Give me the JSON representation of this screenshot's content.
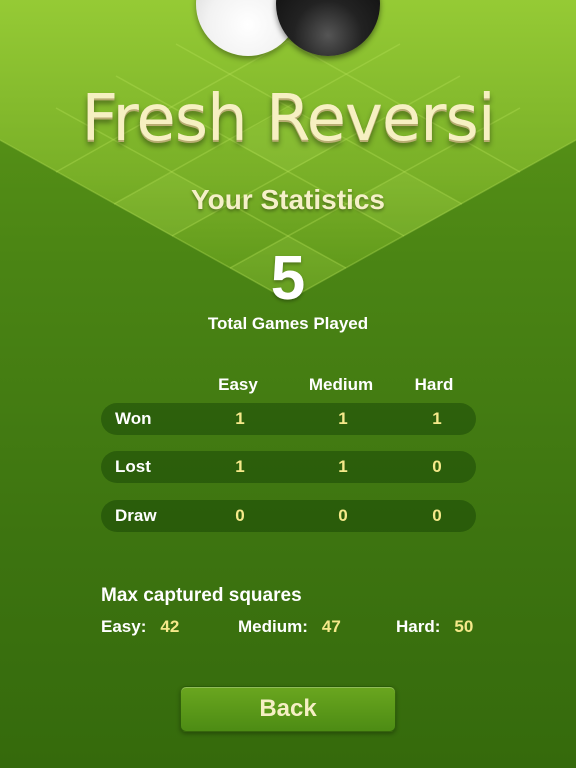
{
  "app": {
    "title": "Fresh Reversi"
  },
  "screen": {
    "subtitle": "Your Statistics"
  },
  "totals": {
    "games_played": "5",
    "games_played_label": "Total Games Played"
  },
  "difficulty_headers": [
    "Easy",
    "Medium",
    "Hard"
  ],
  "stats_rows": [
    {
      "label": "Won",
      "values": [
        "1",
        "1",
        "1"
      ]
    },
    {
      "label": "Lost",
      "values": [
        "1",
        "1",
        "0"
      ]
    },
    {
      "label": "Draw",
      "values": [
        "0",
        "0",
        "0"
      ]
    }
  ],
  "max_captured": {
    "title": "Max captured squares",
    "items": [
      {
        "key": "Easy:",
        "value": "42"
      },
      {
        "key": "Medium:",
        "value": "47"
      },
      {
        "key": "Hard:",
        "value": "50"
      }
    ]
  },
  "actions": {
    "back_label": "Back"
  },
  "colors": {
    "background": "#4a8414",
    "title_text": "#f6f0c2",
    "value_text": "#f5e98a",
    "row_pill": "#1f4a0a"
  },
  "icons": {
    "white_piece": "white-disc-icon",
    "black_piece": "black-disc-icon"
  }
}
